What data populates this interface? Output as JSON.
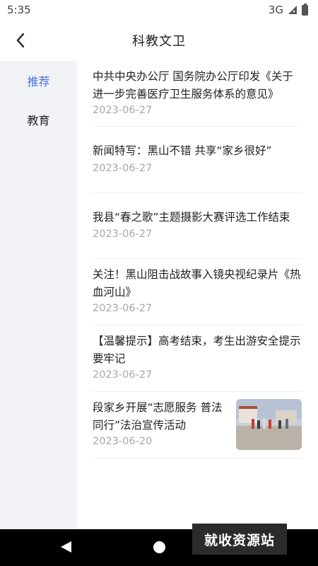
{
  "status": {
    "time": "5:35",
    "network": "3G"
  },
  "header": {
    "title": "科教文卫"
  },
  "sidebar": {
    "items": [
      {
        "label": "推荐"
      },
      {
        "label": "教育"
      }
    ]
  },
  "news": [
    {
      "title": "中共中央办公厅 国务院办公厅印发《关于进一步完善医疗卫生服务体系的意见》",
      "date": "2023-06-27"
    },
    {
      "title": "新闻特写：黑山不错 共享“家乡很好”",
      "date": "2023-06-27"
    },
    {
      "title": "我县“春之歌”主题摄影大赛评选工作结束",
      "date": "2023-06-27"
    },
    {
      "title": "关注！黑山阻击战故事入镜央视纪录片《热血河山》",
      "date": "2023-06-27"
    },
    {
      "title": "【温馨提示】高考结束，考生出游安全提示要牢记",
      "date": "2023-06-27"
    },
    {
      "title": "段家乡开展“志愿服务 普法同行”法治宣传活动",
      "date": "2023-06-20"
    }
  ],
  "watermark": {
    "text": "就收资源站"
  },
  "colors": {
    "accent": "#4a6ee0",
    "sidebar_bg": "#f2f3f7",
    "date": "#a8a8a8"
  },
  "icons": {
    "back": "chevron-left-icon",
    "nav_back": "triangle-back-icon",
    "nav_home": "circle-home-icon"
  }
}
